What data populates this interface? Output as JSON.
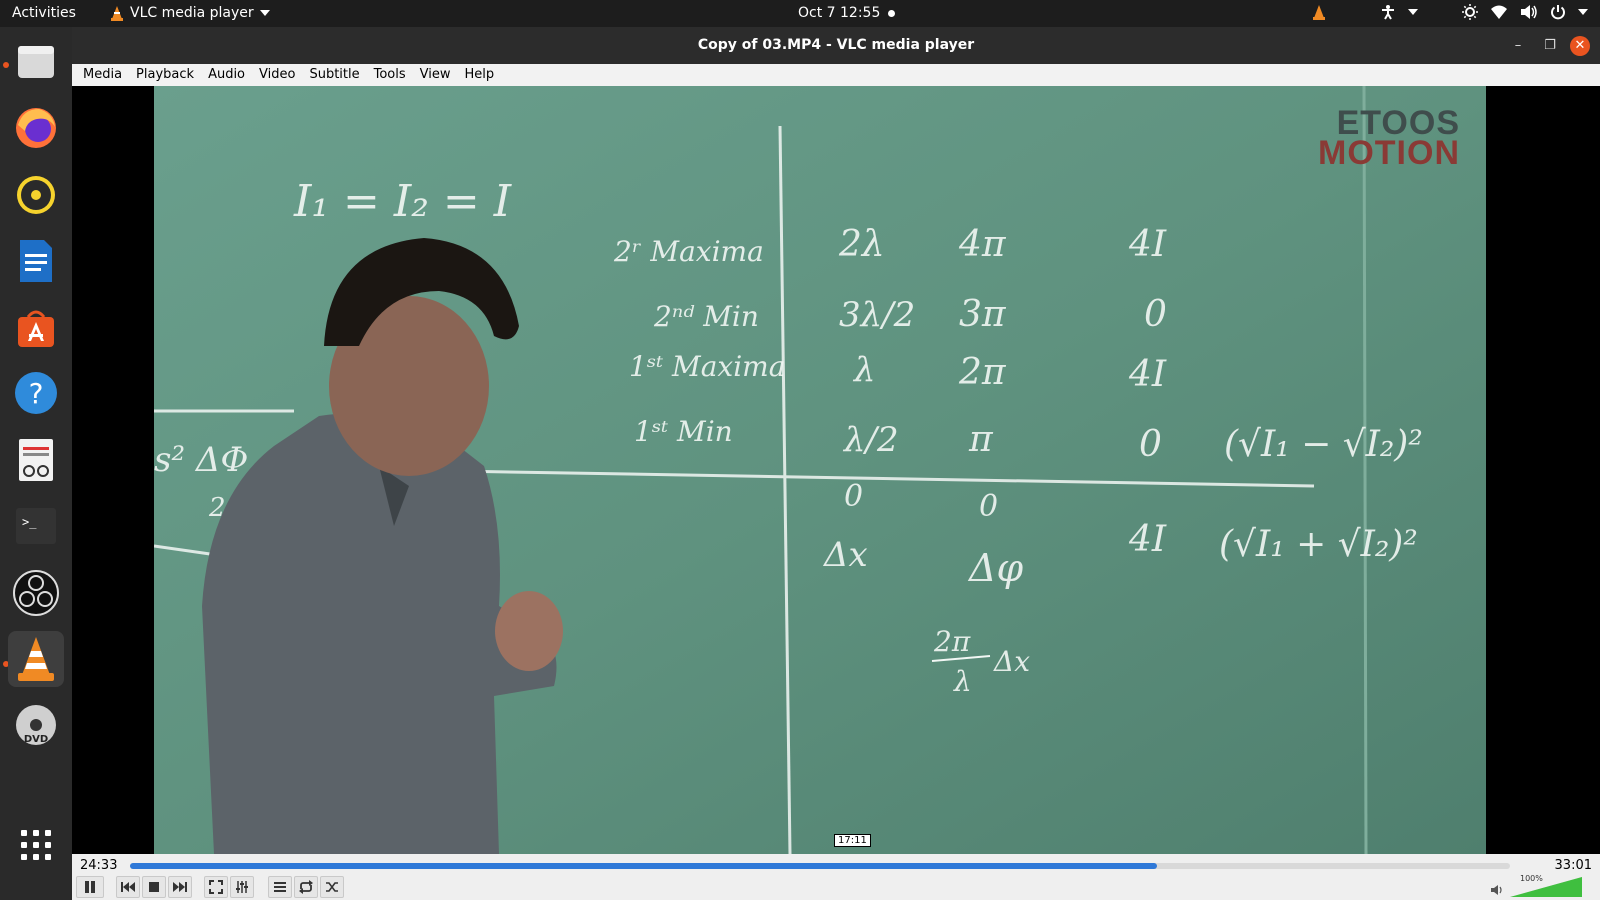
{
  "topbar": {
    "activities": "Activities",
    "app_name": "VLC media player",
    "clock": "Oct 7  12:55"
  },
  "dock": {
    "items": [
      "files-icon",
      "firefox-icon",
      "rhythmbox-icon",
      "writer-icon",
      "software-icon",
      "help-icon",
      "document-viewer-icon",
      "terminal-icon",
      "obs-icon",
      "vlc-icon",
      "dvd-icon",
      "show-apps-icon"
    ]
  },
  "window": {
    "title": "Copy of 03.MP4 - VLC media player",
    "menu": [
      "Media",
      "Playback",
      "Audio",
      "Video",
      "Subtitle",
      "Tools",
      "View",
      "Help"
    ]
  },
  "video": {
    "logo_line1": "ETOOS",
    "logo_line2": "MOTION"
  },
  "player": {
    "elapsed": "24:33",
    "total": "33:01",
    "hover_time": "17:11",
    "progress": 0.744,
    "volume_label": "100%",
    "volume": 1.0
  },
  "colors": {
    "accent": "#2f79d8",
    "ubuntu_orange": "#e95420",
    "chalkboard": "#5e8f7c"
  }
}
